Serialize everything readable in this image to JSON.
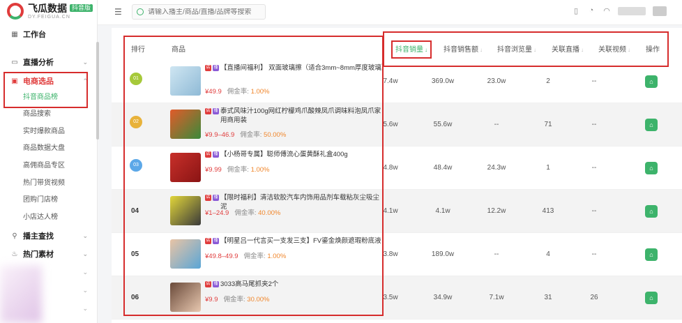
{
  "app": {
    "name": "飞瓜数据",
    "badge": "抖音版",
    "url": "DY.FEIGUA.CN"
  },
  "topbar": {
    "search_placeholder": "请输入播主/商品/直播/品牌等搜索"
  },
  "sidebar": {
    "items": [
      {
        "label": "工作台",
        "icon": "grid-icon"
      },
      {
        "label": "直播分析",
        "icon": "monitor-icon"
      },
      {
        "label": "电商选品",
        "icon": "cart-icon"
      },
      {
        "label": "播主查找",
        "icon": "user-search-icon"
      },
      {
        "label": "热门素材",
        "icon": "fire-icon"
      }
    ],
    "sub_items": [
      "抖音商品榜",
      "商品搜索",
      "实时爆款商品",
      "商品数据大盘",
      "高佣商品专区",
      "热门带货视频",
      "团购门店榜",
      "小店达人榜"
    ]
  },
  "table": {
    "headers": {
      "rank": "排行",
      "product": "商品",
      "sales": "抖音销量",
      "revenue": "抖音销售额",
      "views": "抖音浏览量",
      "live": "关联直播",
      "video": "关联视频",
      "action": "操作"
    },
    "commission_label": "佣金率:",
    "rows": [
      {
        "rank": "01",
        "name": "【直播间福利】 双面玻璃擦（适合3mm~8mm厚度玻璃）",
        "price": "¥49.9",
        "commission": "1.00%",
        "sales": "7.4w",
        "revenue": "369.0w",
        "views": "23.0w",
        "live": "2",
        "video": "--"
      },
      {
        "rank": "02",
        "name": "泰式风味汁100g网红柠檬鸡爪酸辣凤爪调味料泡凤爪家用商用装",
        "price": "¥9.9–46.9",
        "commission": "50.00%",
        "sales": "5.6w",
        "revenue": "55.6w",
        "views": "--",
        "live": "71",
        "video": "--"
      },
      {
        "rank": "03",
        "name": "【小杨哥专属】聪师傅流心蛋黄酥礼盒400g",
        "price": "¥9.99",
        "commission": "1.00%",
        "sales": "4.8w",
        "revenue": "48.4w",
        "views": "24.3w",
        "live": "1",
        "video": "--"
      },
      {
        "rank": "04",
        "name": "【限时福利】清洁软胶汽车内饰用品剂车载粘灰尘吸尘泥",
        "price": "¥1–24.9",
        "commission": "40.00%",
        "sales": "4.1w",
        "revenue": "4.1w",
        "views": "12.2w",
        "live": "413",
        "video": "--"
      },
      {
        "rank": "05",
        "name": "【明星吕一代言买一支发三支】FV鎏金焕颜遮瑕粉底液",
        "price": "¥49.8–49.9",
        "commission": "1.00%",
        "sales": "3.8w",
        "revenue": "189.0w",
        "views": "--",
        "live": "4",
        "video": "--"
      },
      {
        "rank": "06",
        "name": "3033高马尾抓夹2个",
        "price": "¥9.9",
        "commission": "30.00%",
        "sales": "3.5w",
        "revenue": "34.9w",
        "views": "7.1w",
        "live": "31",
        "video": "26"
      }
    ]
  }
}
